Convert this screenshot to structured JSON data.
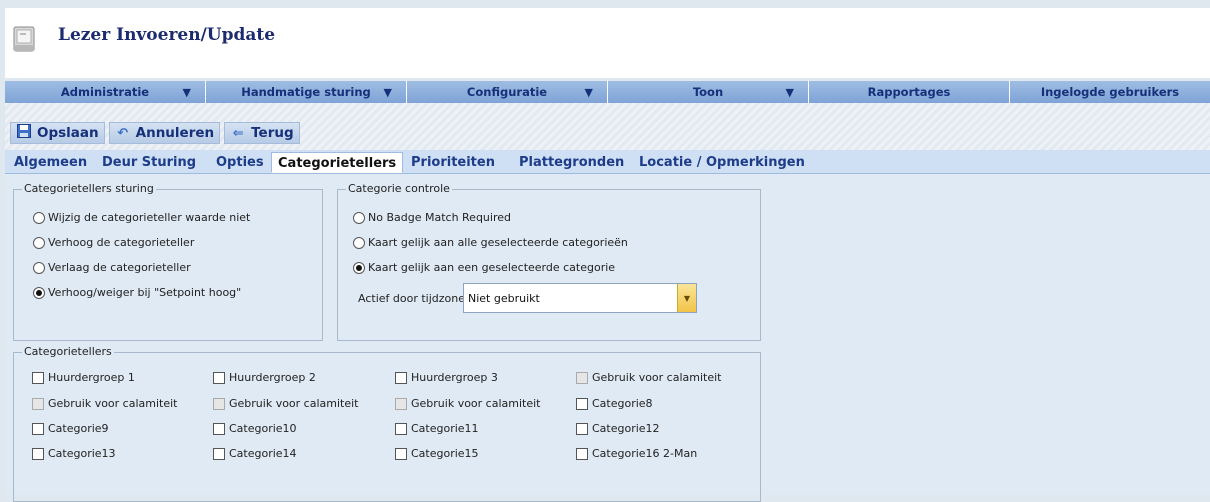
{
  "app": {
    "title": "Lezer Invoeren/Update",
    "icon": "document-icon"
  },
  "menu": [
    {
      "label": "Administratie",
      "arrow": "▼"
    },
    {
      "label": "Handmatige sturing",
      "arrow": "▼"
    },
    {
      "label": "Configuratie",
      "arrow": "▼"
    },
    {
      "label": "Toon",
      "arrow": "▼"
    },
    {
      "label": "Rapportages",
      "arrow": ""
    },
    {
      "label": "Ingelogde gebruikers",
      "arrow": ""
    }
  ],
  "toolbar": {
    "save": {
      "label": "Opslaan",
      "icon": "save-icon"
    },
    "cancel": {
      "label": "Annuleren",
      "icon": "undo-icon"
    },
    "back": {
      "label": "Terug",
      "icon": "back-arrow-icon"
    }
  },
  "tabs": [
    {
      "label": "Algemeen",
      "active": false
    },
    {
      "label": "Deur Sturing",
      "active": false
    },
    {
      "label": "Opties",
      "active": false
    },
    {
      "label": "Categorietellers",
      "active": true
    },
    {
      "label": "Prioriteiten",
      "active": false
    },
    {
      "label": "Plattegronden",
      "active": false
    },
    {
      "label": "Locatie / Opmerkingen",
      "active": false
    }
  ],
  "sturing": {
    "legend": "Categorietellers sturing",
    "options": [
      {
        "label": "Wijzig de categorieteller waarde niet",
        "selected": false
      },
      {
        "label": "Verhoog de categorieteller",
        "selected": false
      },
      {
        "label": "Verlaag de categorieteller",
        "selected": false
      },
      {
        "label": "Verhoog/weiger bij \"Setpoint hoog\"",
        "selected": true
      }
    ]
  },
  "controle": {
    "legend": "Categorie controle",
    "options": [
      {
        "label": "No Badge Match Required",
        "selected": false
      },
      {
        "label": "Kaart gelijk aan alle geselecteerde categorieën",
        "selected": false
      },
      {
        "label": "Kaart gelijk aan een geselecteerde categorie",
        "selected": true
      }
    ],
    "timezone_label": "Actief door tijdzone",
    "timezone_value": "Niet gebruikt"
  },
  "tellers": {
    "legend": "Categorietellers",
    "items": [
      {
        "label": "Huurdergroep 1",
        "checked": false,
        "disabled": false
      },
      {
        "label": "Huurdergroep 2",
        "checked": false,
        "disabled": false
      },
      {
        "label": "Huurdergroep 3",
        "checked": false,
        "disabled": false
      },
      {
        "label": "Gebruik voor calamiteit",
        "checked": false,
        "disabled": true
      },
      {
        "label": "Gebruik voor calamiteit",
        "checked": false,
        "disabled": true
      },
      {
        "label": "Gebruik voor calamiteit",
        "checked": false,
        "disabled": true
      },
      {
        "label": "Gebruik voor calamiteit",
        "checked": false,
        "disabled": true
      },
      {
        "label": "Categorie8",
        "checked": false,
        "disabled": false
      },
      {
        "label": "Categorie9",
        "checked": false,
        "disabled": false
      },
      {
        "label": "Categorie10",
        "checked": false,
        "disabled": false
      },
      {
        "label": "Categorie11",
        "checked": false,
        "disabled": false
      },
      {
        "label": "Categorie12",
        "checked": false,
        "disabled": false
      },
      {
        "label": "Categorie13",
        "checked": false,
        "disabled": false
      },
      {
        "label": "Categorie14",
        "checked": false,
        "disabled": false
      },
      {
        "label": "Categorie15",
        "checked": false,
        "disabled": false
      },
      {
        "label": "Categorie16 2-Man",
        "checked": false,
        "disabled": false
      }
    ]
  }
}
